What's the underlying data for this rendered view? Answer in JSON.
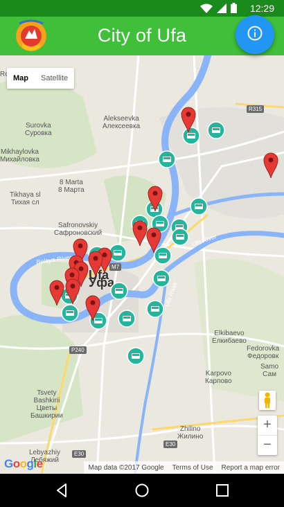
{
  "status": {
    "time": "12:29"
  },
  "app": {
    "title": "City of Ufa"
  },
  "map": {
    "type_options": [
      "Map",
      "Satellite"
    ],
    "selected_type": "Map",
    "labels": [
      {
        "text": "Alekseevka\nАлексеевка"
      },
      {
        "text": "Surovka\nСуровка"
      },
      {
        "text": "Mikhaylovka\nМихайловка"
      },
      {
        "text": "8 Marta\n8 Марта"
      },
      {
        "text": "Tikhaya sl\nТихая сл"
      },
      {
        "text": "Safronovskiy\nСафроновский"
      },
      {
        "text": "Elkibaevo\nЕлкибаево"
      },
      {
        "text": "Fedorovka\nФедоровк"
      },
      {
        "text": "Samo\nСам"
      },
      {
        "text": "Karpovo\nКарпово"
      },
      {
        "text": "Tsvety\nBashkirii\nЦветы\nБашкирии"
      },
      {
        "text": "Zhilino\nЖилино"
      },
      {
        "text": "Lebyazhiy\nЛебяжий"
      },
      {
        "text": "Ronovskiy"
      }
    ],
    "city_label": "Ufa\nУфа",
    "rivers": [
      "Belaya River",
      "Ufa River",
      "Ufa River"
    ],
    "shields": [
      "R315",
      "M7",
      "P240",
      "E30",
      "E30"
    ],
    "zoom_in": "+",
    "zoom_out": "−",
    "google_logo": "Google",
    "attribution": [
      "Map data ©2017 Google",
      "Terms of Use",
      "Report a map error"
    ]
  },
  "colors": {
    "appbar": "#3fbf3a",
    "statusbar": "#1a8a1c",
    "fab": "#2196f3",
    "marker_red": "#e53935",
    "bus_icon": "#26b59a",
    "river": "#8ab4f8"
  }
}
